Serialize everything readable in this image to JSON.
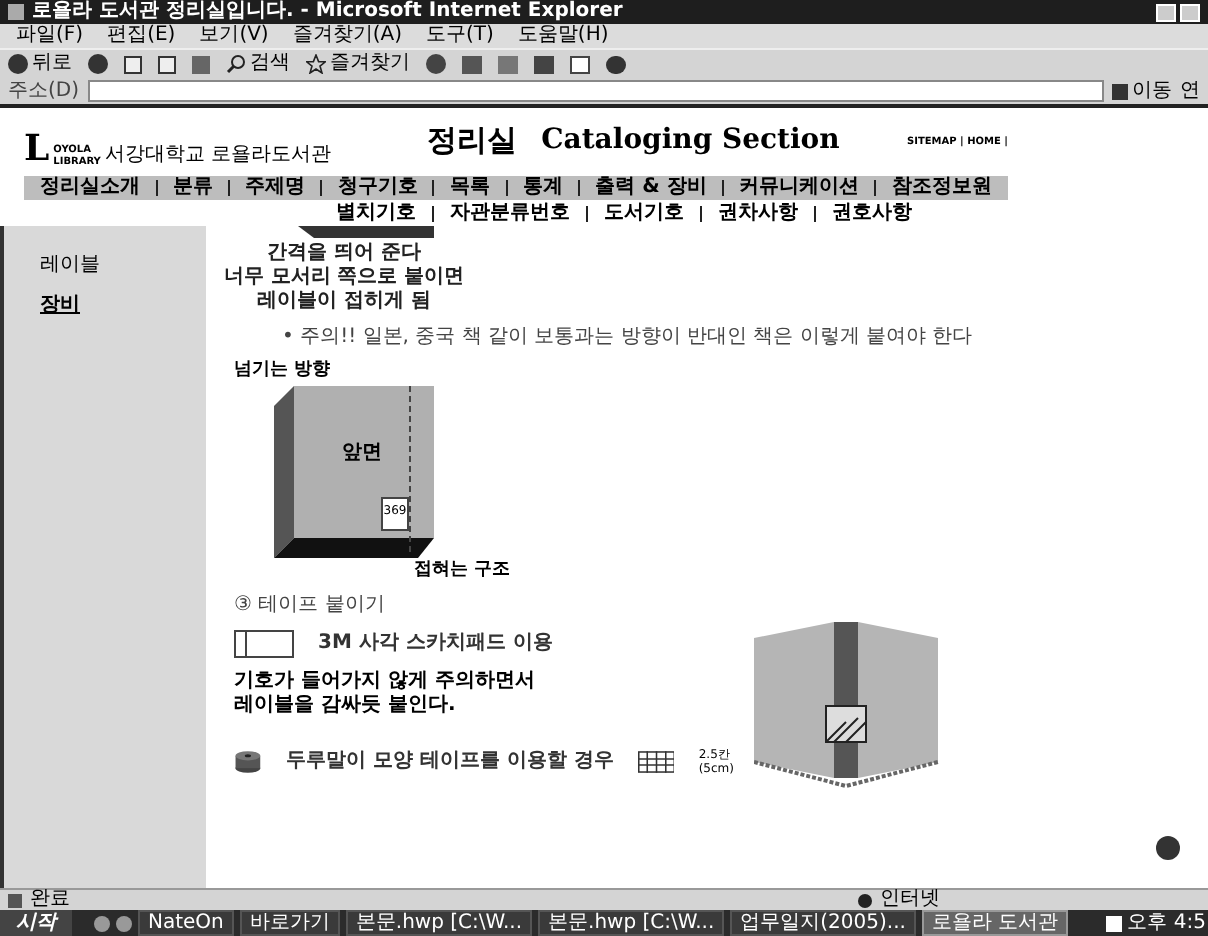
{
  "window": {
    "title": "로욜라 도서관 정리실입니다. - Microsoft Internet Explorer"
  },
  "menu": [
    "파일(F)",
    "편집(E)",
    "보기(V)",
    "즐겨찾기(A)",
    "도구(T)",
    "도움말(H)"
  ],
  "toolbar": {
    "back": "뒤로",
    "search": "검색",
    "favorites": "즐겨찾기"
  },
  "address": {
    "label": "주소(D)",
    "go": "이동",
    "cut_label": "연"
  },
  "site": {
    "logo_initial": "L",
    "logo_small": [
      "OYOLA",
      "LIBRARY"
    ],
    "logo_name": "서강대학교 로욜라도서관",
    "title": "정리실",
    "subtitle": "Cataloging Section",
    "links": "SITEMAP | HOME |"
  },
  "nav": [
    "정리실소개",
    "분류",
    "주제명",
    "청구기호",
    "목록",
    "통계",
    "출력 & 장비",
    "커뮤니케이션",
    "참조정보원"
  ],
  "subnav": [
    "별치기호",
    "자관분류번호",
    "도서기호",
    "권차사항",
    "권호사항"
  ],
  "sidebar": [
    {
      "label": "레이블",
      "selected": false
    },
    {
      "label": "장비",
      "selected": true
    }
  ],
  "content": {
    "caption_lines": [
      "간격을 띄어 준다",
      "너무 모서리 쪽으로 붙이면",
      "레이블이 접히게 됨"
    ],
    "notice": "• 주의!! 일본, 중국 책 같이 보통과는 방향이 반대인 책은 이렇게 붙여야 한다",
    "book": {
      "direction_label": "넘기는 방향",
      "face_label": "앞면",
      "spine_number": "369",
      "fold_label": "접혀는 구조"
    },
    "step_title": "③ 테이프 붙이기",
    "tape": {
      "pad_label": "3M 사각 스카치패드 이용",
      "instruction_lines": [
        "기호가 들어가지 않게 주의하면서",
        "레이블을 감싸듯 붙인다."
      ],
      "roll_label": "두루말이 모양 테이프를 이용할 경우",
      "grid_label_lines": [
        "2.5칸",
        "(5cm)"
      ]
    }
  },
  "status": {
    "text": "완료",
    "zone": "인터넷"
  },
  "taskbar": {
    "start": "시작",
    "items": [
      {
        "label": "NateOn",
        "selected": false
      },
      {
        "label": "바로가기",
        "selected": false
      },
      {
        "label": "본문.hwp [C:\\W...",
        "selected": false
      },
      {
        "label": "본문.hwp [C:\\W...",
        "selected": false
      },
      {
        "label": "업무일지(2005)...",
        "selected": false
      },
      {
        "label": "로욜라 도서관",
        "selected": true
      }
    ],
    "clock": "오후 4:5"
  }
}
